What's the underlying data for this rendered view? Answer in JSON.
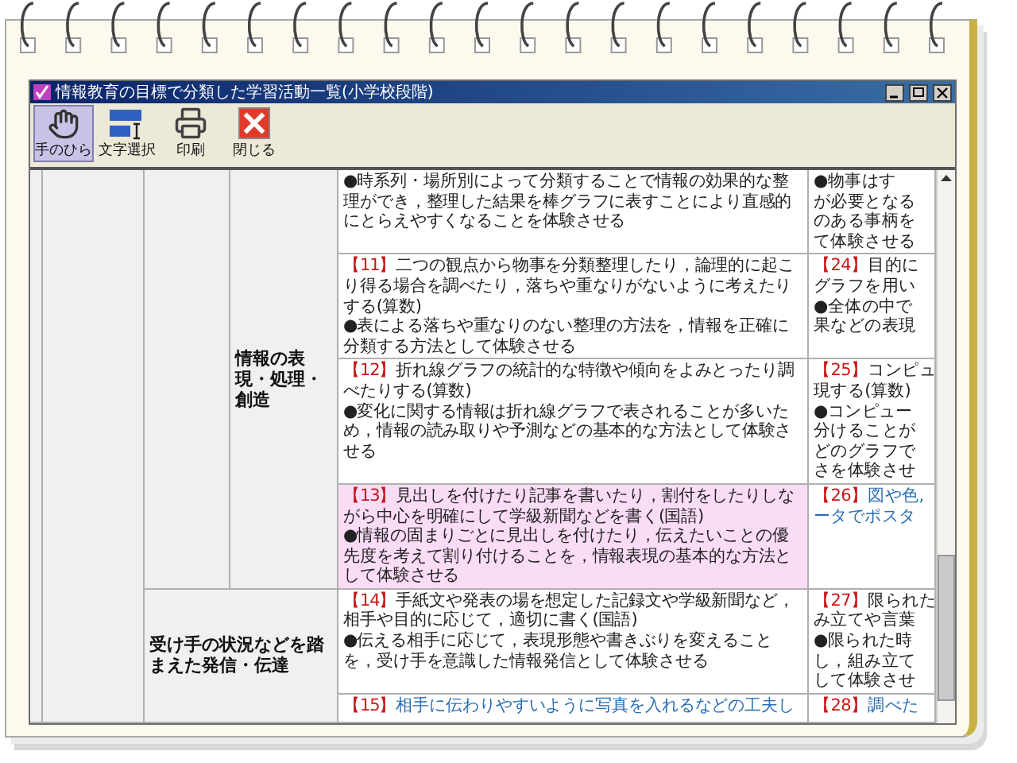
{
  "window": {
    "title": "情報教育の目標で分類した学習活動一覧(小学校段階)"
  },
  "toolbar": [
    {
      "kind": "hand",
      "label": "手のひら",
      "selected": true
    },
    {
      "kind": "textselect",
      "label": "文字選択",
      "selected": false
    },
    {
      "kind": "print",
      "label": "印刷",
      "selected": false
    },
    {
      "kind": "close",
      "label": "閉じる",
      "selected": false
    }
  ],
  "table": {
    "groups": [
      {
        "category": "情報の表現・処理・創造",
        "rows": [
          {
            "selected": false,
            "main": {
              "text": "●時系列・場所別によって分類することで情報の効果的な整理ができ，整理した結果を棒グラフに表すことにより直感的にとらえやすくなることを体験させる",
              "color": "#222222"
            },
            "side": {
              "lines": [
                "●物事はす",
                "が必要となる",
                "のある事柄を",
                "て体験させる"
              ],
              "color": "#222222"
            }
          },
          {
            "selected": false,
            "main": {
              "number": "【11】",
              "text": "二つの観点から物事を分類整理したり，論理的に起こり得る場合を調べたり，落ちや重なりがないように考えたりする(算数)\n●表による落ちや重なりのない整理の方法を，情報を正確に分類する方法として体験させる",
              "color": "#222222"
            },
            "side": {
              "number": "【24】",
              "lines": [
                "目的に",
                "グラフを用い",
                "●全体の中で",
                "果などの表現"
              ],
              "color": "#222222"
            }
          },
          {
            "selected": false,
            "main": {
              "number": "【12】",
              "text": "折れ線グラフの統計的な特徴や傾向をよみとったり調べたりする(算数)\n●変化に関する情報は折れ線グラフで表されることが多いため，情報の読み取りや予測などの基本的な方法として体験させる",
              "color": "#222222"
            },
            "side": {
              "number": "【25】",
              "lines": [
                "コンピュ",
                "現する(算数)",
                "●コンピュー",
                "分けることが",
                "どのグラフで",
                "さを体験させ"
              ],
              "color": "#222222"
            }
          },
          {
            "selected": true,
            "main": {
              "number": "【13】",
              "text": "見出しを付けたり記事を書いたり，割付をしたりしながら中心を明確にして学級新聞などを書く(国語)\n●情報の固まりごとに見出しを付けたり，伝えたいことの優先度を考えて割り付けることを，情報表現の基本的な方法として体験させる",
              "color": "#222222"
            },
            "side": {
              "number": "【26】",
              "lines": [
                "図や色,",
                "ータでポスタ"
              ],
              "color": "#2a6db5"
            }
          }
        ]
      },
      {
        "category": "受け手の状況などを踏まえた発信・伝達",
        "rows": [
          {
            "selected": false,
            "main": {
              "number": "【14】",
              "text": "手紙文や発表の場を想定した記録文や学級新聞など，相手や目的に応じて，適切に書く(国語)\n●伝える相手に応じて，表現形態や書きぶりを変えることを，受け手を意識した情報発信として体験させる",
              "color": "#222222"
            },
            "side": {
              "number": "【27】",
              "lines": [
                "限られた",
                "み立てや言葉",
                "●限られた時",
                "し，組み立て",
                "して体験させ"
              ],
              "color": "#222222"
            }
          },
          {
            "selected": false,
            "main": {
              "number": "【15】",
              "text": "相手に伝わりやすいように写真を入れるなどの工夫し",
              "color": "#2a6db5"
            },
            "side": {
              "number": "【28】",
              "lines": [
                "調べた"
              ],
              "color": "#2a6db5"
            }
          }
        ]
      }
    ]
  }
}
